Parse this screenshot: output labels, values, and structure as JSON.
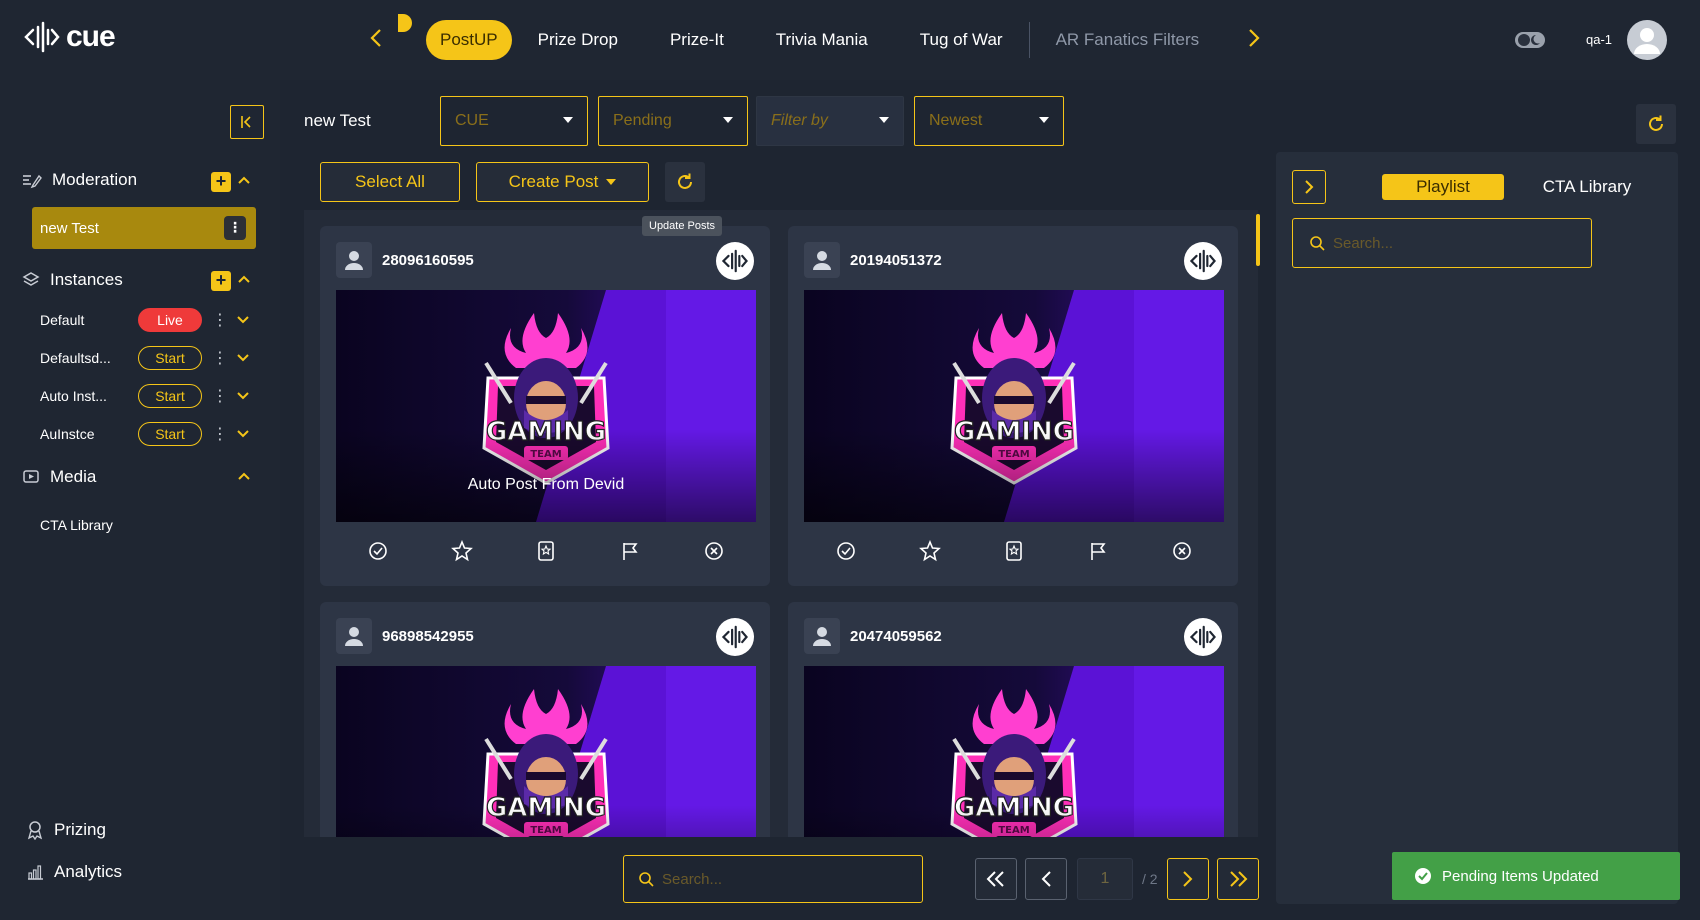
{
  "app": {
    "logo_text": "cue"
  },
  "nav": {
    "tabs": [
      {
        "label": "PostUP",
        "active": true
      },
      {
        "label": "Prize Drop"
      },
      {
        "label": "Prize-It"
      },
      {
        "label": "Trivia Mania"
      },
      {
        "label": "Tug of War"
      },
      {
        "label": "AR Fanatics Filters",
        "dimmed": true
      }
    ],
    "user": "qa-1"
  },
  "sidebar": {
    "moderation_label": "Moderation",
    "selected_item": "new Test",
    "instances_label": "Instances",
    "instances": [
      {
        "name": "Default",
        "status": "Live"
      },
      {
        "name": "Defaultsd...",
        "status": "Start"
      },
      {
        "name": "Auto Inst...",
        "status": "Start"
      },
      {
        "name": "AuInstce",
        "status": "Start"
      }
    ],
    "media_label": "Media",
    "media_items": [
      "CTA Library"
    ],
    "prizing_label": "Prizing",
    "analytics_label": "Analytics"
  },
  "toolbar": {
    "title": "new Test",
    "source_select": "CUE",
    "status_select": "Pending",
    "filter_placeholder": "Filter by",
    "sort_select": "Newest",
    "select_all": "Select All",
    "create_post": "Create Post",
    "refresh_tooltip": "Update Posts"
  },
  "posts": [
    {
      "id": "28096160595",
      "caption": "Auto Post From Devid"
    },
    {
      "id": "20194051372",
      "caption": ""
    },
    {
      "id": "96898542955",
      "caption": ""
    },
    {
      "id": "20474059562",
      "caption": ""
    }
  ],
  "post_image": {
    "badge_text": "GAMING",
    "ribbon_text": "TEAM"
  },
  "pagination": {
    "search_placeholder": "Search...",
    "current_page": "1",
    "total_pages": "/ 2"
  },
  "right_panel": {
    "tabs": [
      "Playlist",
      "CTA Library"
    ],
    "active_tab": "Playlist",
    "search_placeholder": "Search..."
  },
  "toast": {
    "message": "Pending Items Updated"
  },
  "colors": {
    "accent": "#f5c518",
    "live": "#ef3a3a",
    "success": "#43a047",
    "bg": "#1e2531"
  }
}
